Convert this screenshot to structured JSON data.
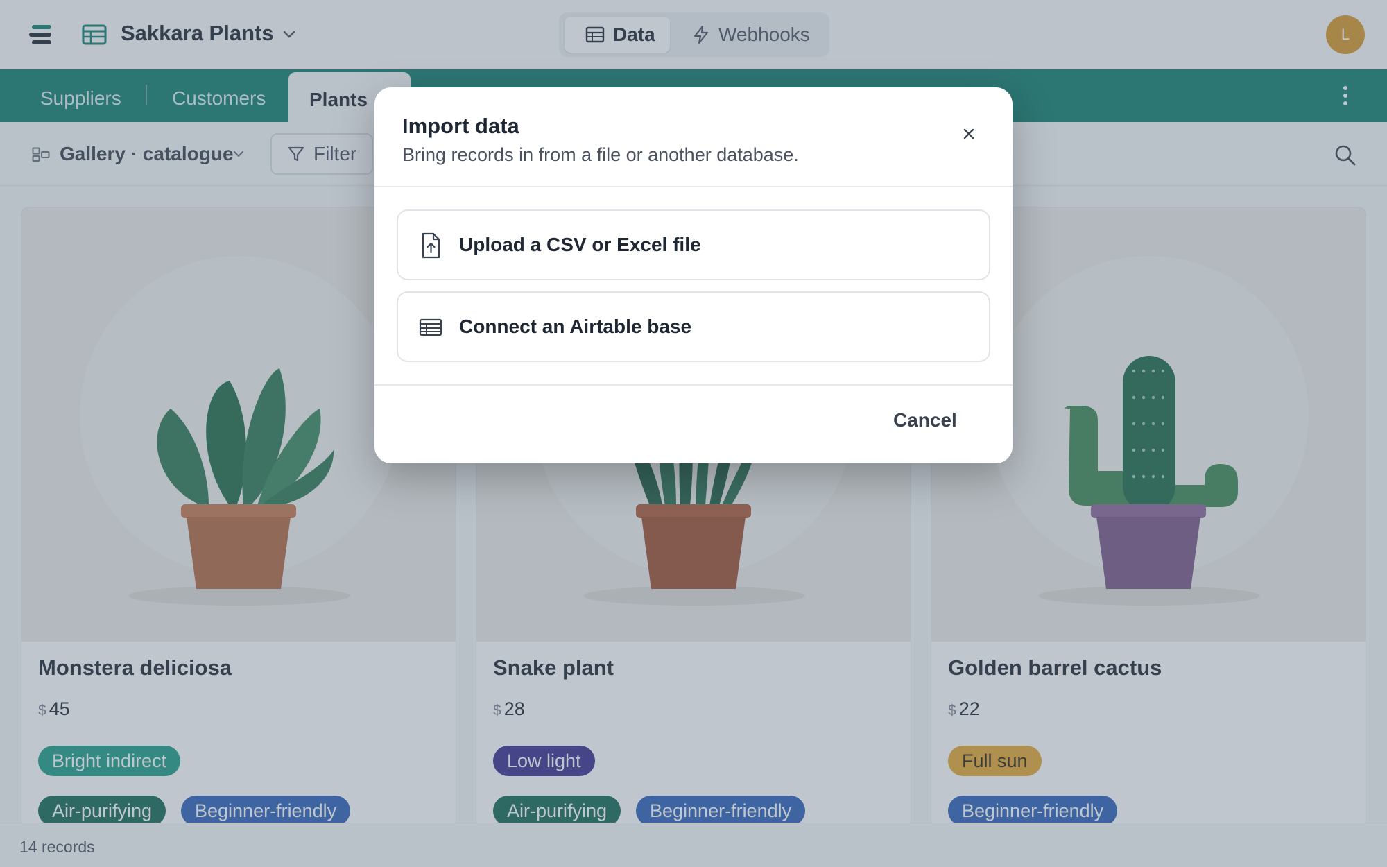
{
  "app": {
    "base_name": "Sakkara Plants",
    "avatar_initial": "L",
    "segments": [
      {
        "label": "Data",
        "active": true,
        "icon": "table-icon"
      },
      {
        "label": "Webhooks",
        "active": false,
        "icon": "bolt-icon"
      }
    ]
  },
  "tabs": {
    "items": [
      "Suppliers",
      "Customers",
      "Plants"
    ],
    "active": "Plants"
  },
  "view": {
    "label": "Gallery · catalogue",
    "filter_label": "Filter"
  },
  "cards": [
    {
      "name": "Monstera deliciosa",
      "currency": "$",
      "price": "45",
      "light_tag": {
        "label": "Bright indirect",
        "color": "#1f9e86",
        "text": "#ffffff"
      },
      "tags": [
        {
          "label": "Air-purifying",
          "color": "#176a55",
          "text": "#ffffff"
        },
        {
          "label": "Beginner-friendly",
          "color": "#2f63b8",
          "text": "#ffffff"
        }
      ],
      "pot_color": "#b56a45",
      "plant": "monstera"
    },
    {
      "name": "Snake plant",
      "currency": "$",
      "price": "28",
      "light_tag": {
        "label": "Low light",
        "color": "#3b2f8f",
        "text": "#ffffff"
      },
      "tags": [
        {
          "label": "Air-purifying",
          "color": "#176a55",
          "text": "#ffffff"
        },
        {
          "label": "Beginner-friendly",
          "color": "#2f63b8",
          "text": "#ffffff"
        }
      ],
      "pot_color": "#a14f33",
      "plant": "snake-plant"
    },
    {
      "name": "Golden barrel cactus",
      "currency": "$",
      "price": "22",
      "light_tag": {
        "label": "Full sun",
        "color": "#e6a935",
        "text": "#2a2110"
      },
      "tags": [
        {
          "label": "Beginner-friendly",
          "color": "#2f63b8",
          "text": "#ffffff"
        }
      ],
      "pot_color": "#7f5788",
      "plant": "cactus"
    }
  ],
  "footer": {
    "record_count": "14 records"
  },
  "modal": {
    "title": "Import data",
    "subtitle": "Bring records in from a file or another database.",
    "options": [
      {
        "label": "Upload a CSV or Excel file",
        "icon": "file-upload-icon"
      },
      {
        "label": "Connect an Airtable base",
        "icon": "table-icon"
      }
    ],
    "cancel_label": "Cancel"
  },
  "colors": {
    "brand_green": "#137e6f",
    "avatar": "#d99a2b"
  }
}
